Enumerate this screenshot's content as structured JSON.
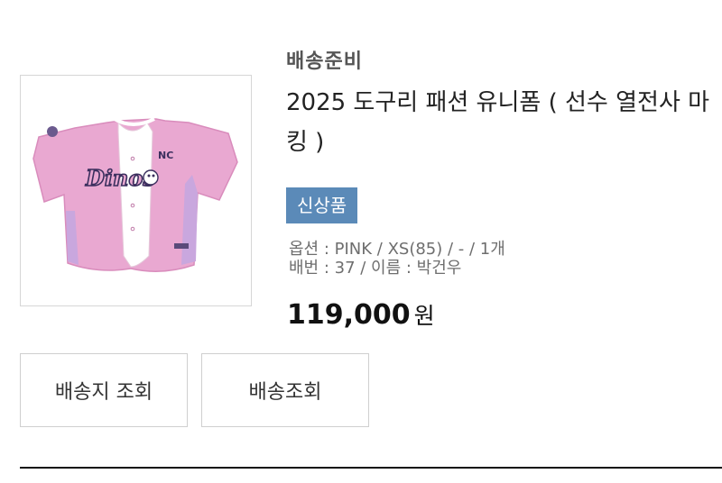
{
  "order": {
    "status": "배송준비",
    "product_title": "2025 도구리 패션 유니폼 ( 선수 열전사 마킹 )",
    "badge": "신상품",
    "options_line1": "옵션 : PINK / XS(85) / - / 1개",
    "options_line2": "배번 : 37 / 이름 : 박건우",
    "price": "119,000",
    "price_unit": "원",
    "image": {
      "jersey_logo": "Dinos",
      "jersey_patch": "NC",
      "jersey_color": "#e9a8d1"
    }
  },
  "buttons": {
    "address_label": "배송지 조회",
    "tracking_label": "배송조회"
  }
}
